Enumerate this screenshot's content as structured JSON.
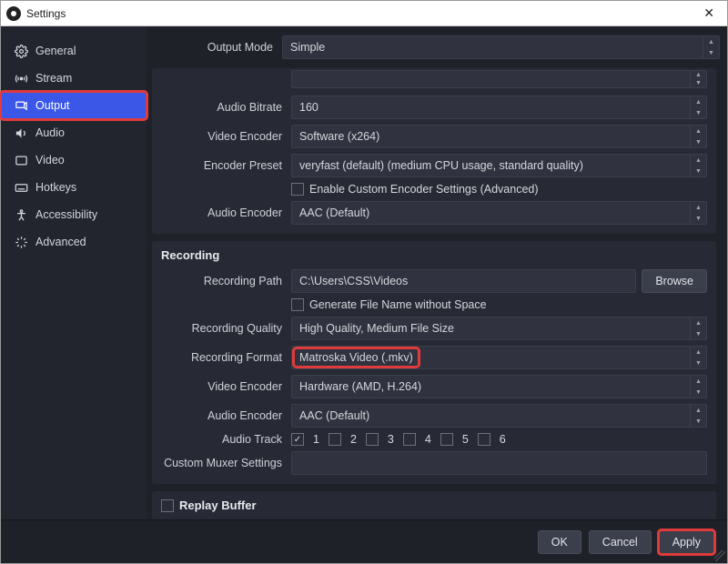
{
  "window": {
    "title": "Settings"
  },
  "sidebar": {
    "items": [
      {
        "label": "General"
      },
      {
        "label": "Stream"
      },
      {
        "label": "Output"
      },
      {
        "label": "Audio"
      },
      {
        "label": "Video"
      },
      {
        "label": "Hotkeys"
      },
      {
        "label": "Accessibility"
      },
      {
        "label": "Advanced"
      }
    ]
  },
  "output_mode": {
    "label": "Output Mode",
    "value": "Simple"
  },
  "streaming": {
    "audio_bitrate": {
      "label": "Audio Bitrate",
      "value": "160"
    },
    "video_encoder": {
      "label": "Video Encoder",
      "value": "Software (x264)"
    },
    "encoder_preset": {
      "label": "Encoder Preset",
      "value": "veryfast (default) (medium CPU usage, standard quality)"
    },
    "custom_encoder_cb": "Enable Custom Encoder Settings (Advanced)",
    "audio_encoder": {
      "label": "Audio Encoder",
      "value": "AAC (Default)"
    }
  },
  "recording": {
    "title": "Recording",
    "path": {
      "label": "Recording Path",
      "value": "C:\\Users\\CSS\\Videos"
    },
    "browse": "Browse",
    "gen_no_space": "Generate File Name without Space",
    "quality": {
      "label": "Recording Quality",
      "value": "High Quality, Medium File Size"
    },
    "format": {
      "label": "Recording Format",
      "value": "Matroska Video (.mkv)"
    },
    "video_encoder": {
      "label": "Video Encoder",
      "value": "Hardware (AMD, H.264)"
    },
    "audio_encoder": {
      "label": "Audio Encoder",
      "value": "AAC (Default)"
    },
    "audio_track": {
      "label": "Audio Track",
      "tracks": [
        "1",
        "2",
        "3",
        "4",
        "5",
        "6"
      ]
    },
    "muxer": {
      "label": "Custom Muxer Settings",
      "value": ""
    }
  },
  "replay_buffer": {
    "title": "Replay Buffer"
  },
  "footer": {
    "ok": "OK",
    "cancel": "Cancel",
    "apply": "Apply"
  }
}
